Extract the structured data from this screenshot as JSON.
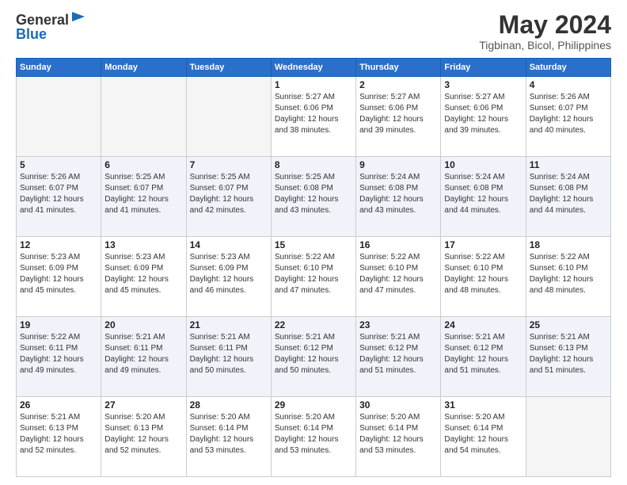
{
  "header": {
    "logo_line1": "General",
    "logo_line2": "Blue",
    "month": "May 2024",
    "location": "Tigbinan, Bicol, Philippines"
  },
  "weekdays": [
    "Sunday",
    "Monday",
    "Tuesday",
    "Wednesday",
    "Thursday",
    "Friday",
    "Saturday"
  ],
  "weeks": [
    [
      {
        "day": "",
        "sunrise": "",
        "sunset": "",
        "daylight": ""
      },
      {
        "day": "",
        "sunrise": "",
        "sunset": "",
        "daylight": ""
      },
      {
        "day": "",
        "sunrise": "",
        "sunset": "",
        "daylight": ""
      },
      {
        "day": "1",
        "sunrise": "Sunrise: 5:27 AM",
        "sunset": "Sunset: 6:06 PM",
        "daylight": "Daylight: 12 hours and 38 minutes."
      },
      {
        "day": "2",
        "sunrise": "Sunrise: 5:27 AM",
        "sunset": "Sunset: 6:06 PM",
        "daylight": "Daylight: 12 hours and 39 minutes."
      },
      {
        "day": "3",
        "sunrise": "Sunrise: 5:27 AM",
        "sunset": "Sunset: 6:06 PM",
        "daylight": "Daylight: 12 hours and 39 minutes."
      },
      {
        "day": "4",
        "sunrise": "Sunrise: 5:26 AM",
        "sunset": "Sunset: 6:07 PM",
        "daylight": "Daylight: 12 hours and 40 minutes."
      }
    ],
    [
      {
        "day": "5",
        "sunrise": "Sunrise: 5:26 AM",
        "sunset": "Sunset: 6:07 PM",
        "daylight": "Daylight: 12 hours and 41 minutes."
      },
      {
        "day": "6",
        "sunrise": "Sunrise: 5:25 AM",
        "sunset": "Sunset: 6:07 PM",
        "daylight": "Daylight: 12 hours and 41 minutes."
      },
      {
        "day": "7",
        "sunrise": "Sunrise: 5:25 AM",
        "sunset": "Sunset: 6:07 PM",
        "daylight": "Daylight: 12 hours and 42 minutes."
      },
      {
        "day": "8",
        "sunrise": "Sunrise: 5:25 AM",
        "sunset": "Sunset: 6:08 PM",
        "daylight": "Daylight: 12 hours and 43 minutes."
      },
      {
        "day": "9",
        "sunrise": "Sunrise: 5:24 AM",
        "sunset": "Sunset: 6:08 PM",
        "daylight": "Daylight: 12 hours and 43 minutes."
      },
      {
        "day": "10",
        "sunrise": "Sunrise: 5:24 AM",
        "sunset": "Sunset: 6:08 PM",
        "daylight": "Daylight: 12 hours and 44 minutes."
      },
      {
        "day": "11",
        "sunrise": "Sunrise: 5:24 AM",
        "sunset": "Sunset: 6:08 PM",
        "daylight": "Daylight: 12 hours and 44 minutes."
      }
    ],
    [
      {
        "day": "12",
        "sunrise": "Sunrise: 5:23 AM",
        "sunset": "Sunset: 6:09 PM",
        "daylight": "Daylight: 12 hours and 45 minutes."
      },
      {
        "day": "13",
        "sunrise": "Sunrise: 5:23 AM",
        "sunset": "Sunset: 6:09 PM",
        "daylight": "Daylight: 12 hours and 45 minutes."
      },
      {
        "day": "14",
        "sunrise": "Sunrise: 5:23 AM",
        "sunset": "Sunset: 6:09 PM",
        "daylight": "Daylight: 12 hours and 46 minutes."
      },
      {
        "day": "15",
        "sunrise": "Sunrise: 5:22 AM",
        "sunset": "Sunset: 6:10 PM",
        "daylight": "Daylight: 12 hours and 47 minutes."
      },
      {
        "day": "16",
        "sunrise": "Sunrise: 5:22 AM",
        "sunset": "Sunset: 6:10 PM",
        "daylight": "Daylight: 12 hours and 47 minutes."
      },
      {
        "day": "17",
        "sunrise": "Sunrise: 5:22 AM",
        "sunset": "Sunset: 6:10 PM",
        "daylight": "Daylight: 12 hours and 48 minutes."
      },
      {
        "day": "18",
        "sunrise": "Sunrise: 5:22 AM",
        "sunset": "Sunset: 6:10 PM",
        "daylight": "Daylight: 12 hours and 48 minutes."
      }
    ],
    [
      {
        "day": "19",
        "sunrise": "Sunrise: 5:22 AM",
        "sunset": "Sunset: 6:11 PM",
        "daylight": "Daylight: 12 hours and 49 minutes."
      },
      {
        "day": "20",
        "sunrise": "Sunrise: 5:21 AM",
        "sunset": "Sunset: 6:11 PM",
        "daylight": "Daylight: 12 hours and 49 minutes."
      },
      {
        "day": "21",
        "sunrise": "Sunrise: 5:21 AM",
        "sunset": "Sunset: 6:11 PM",
        "daylight": "Daylight: 12 hours and 50 minutes."
      },
      {
        "day": "22",
        "sunrise": "Sunrise: 5:21 AM",
        "sunset": "Sunset: 6:12 PM",
        "daylight": "Daylight: 12 hours and 50 minutes."
      },
      {
        "day": "23",
        "sunrise": "Sunrise: 5:21 AM",
        "sunset": "Sunset: 6:12 PM",
        "daylight": "Daylight: 12 hours and 51 minutes."
      },
      {
        "day": "24",
        "sunrise": "Sunrise: 5:21 AM",
        "sunset": "Sunset: 6:12 PM",
        "daylight": "Daylight: 12 hours and 51 minutes."
      },
      {
        "day": "25",
        "sunrise": "Sunrise: 5:21 AM",
        "sunset": "Sunset: 6:13 PM",
        "daylight": "Daylight: 12 hours and 51 minutes."
      }
    ],
    [
      {
        "day": "26",
        "sunrise": "Sunrise: 5:21 AM",
        "sunset": "Sunset: 6:13 PM",
        "daylight": "Daylight: 12 hours and 52 minutes."
      },
      {
        "day": "27",
        "sunrise": "Sunrise: 5:20 AM",
        "sunset": "Sunset: 6:13 PM",
        "daylight": "Daylight: 12 hours and 52 minutes."
      },
      {
        "day": "28",
        "sunrise": "Sunrise: 5:20 AM",
        "sunset": "Sunset: 6:14 PM",
        "daylight": "Daylight: 12 hours and 53 minutes."
      },
      {
        "day": "29",
        "sunrise": "Sunrise: 5:20 AM",
        "sunset": "Sunset: 6:14 PM",
        "daylight": "Daylight: 12 hours and 53 minutes."
      },
      {
        "day": "30",
        "sunrise": "Sunrise: 5:20 AM",
        "sunset": "Sunset: 6:14 PM",
        "daylight": "Daylight: 12 hours and 53 minutes."
      },
      {
        "day": "31",
        "sunrise": "Sunrise: 5:20 AM",
        "sunset": "Sunset: 6:14 PM",
        "daylight": "Daylight: 12 hours and 54 minutes."
      },
      {
        "day": "",
        "sunrise": "",
        "sunset": "",
        "daylight": ""
      }
    ]
  ]
}
